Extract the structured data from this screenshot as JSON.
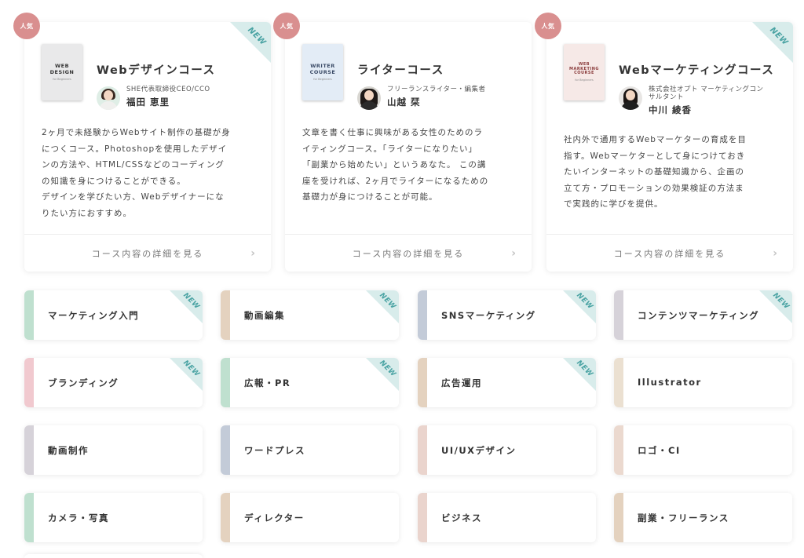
{
  "popular_badge": "人気",
  "new_label": "NEW",
  "courses": [
    {
      "cover_title": "WEB\nDESIGN",
      "cover_sub": "for Beginners",
      "title": "Webデザインコース",
      "instructor_title": "SHE代表取締役CEO/CCO",
      "instructor_name": "福田 恵里",
      "description": "2ヶ月で未経験からWebサイト制作の基礎が身\nにつくコース。Photoshopを使用したデザイ\nンの方法や、HTML/CSSなどのコーディング\nの知識を身につけることができる。\nデザインを学びたい方、Webデザイナーにな\nりたい方におすすめ。",
      "link_label": "コース内容の詳細を見る"
    },
    {
      "cover_title": "WRITER\nCOURSE",
      "cover_sub": "for Beginners",
      "title": "ライターコース",
      "instructor_title": "フリーランスライター・編集者",
      "instructor_name": "山越 栞",
      "description": "文章を書く仕事に興味がある女性のためのラ\nイティングコース。「ライターになりたい」\n「副業から始めたい」というあなた。 この講\n座を受ければ、2ヶ月でライターになるための\n基礎力が身につけることが可能。",
      "link_label": "コース内容の詳細を見る"
    },
    {
      "cover_title": "WEB\nMARKETING\nCOURSE",
      "cover_sub": "for Beginners",
      "title": "Webマーケティングコース",
      "instructor_title": "株式会社オプト マーケティングコンサルタント",
      "instructor_name": "中川 綾香",
      "description": "社内外で通用するWebマーケターの育成を目\n指す。Webマーケターとして身につけておき\nたいインターネットの基礎知識から、企画の\n立て方・プロモーションの効果検証の方法ま\nで実践的に学びを提供。",
      "link_label": "コース内容の詳細を見る"
    }
  ],
  "categories": [
    {
      "label": "マーケティング入門",
      "new": true,
      "color": "#bfe0cf"
    },
    {
      "label": "動画編集",
      "new": true,
      "color": "#e4d2bf"
    },
    {
      "label": "SNSマーケティング",
      "new": true,
      "color": "#c3cbd8"
    },
    {
      "label": "コンテンツマーケティング",
      "new": true,
      "color": "#d6d2d9"
    },
    {
      "label": "ブランディング",
      "new": true,
      "color": "#f1c9cf"
    },
    {
      "label": "広報・PR",
      "new": true,
      "color": "#bfe0cf"
    },
    {
      "label": "広告運用",
      "new": true,
      "color": "#e4d2bf"
    },
    {
      "label": "Illustrator",
      "new": false,
      "color": "#ebe0d1"
    },
    {
      "label": "動画制作",
      "new": false,
      "color": "#d6d2d9"
    },
    {
      "label": "ワードプレス",
      "new": false,
      "color": "#c3cbd8"
    },
    {
      "label": "UI/UXデザイン",
      "new": false,
      "color": "#ead4cd"
    },
    {
      "label": "ロゴ・CI",
      "new": false,
      "color": "#ebd9cf"
    },
    {
      "label": "カメラ・写真",
      "new": false,
      "color": "#bfe0cf"
    },
    {
      "label": "ディレクター",
      "new": false,
      "color": "#e4d2bf"
    },
    {
      "label": "ビジネス",
      "new": false,
      "color": "#ead4cd"
    },
    {
      "label": "副業・フリーランス",
      "new": false,
      "color": "#e4d2bf"
    }
  ]
}
